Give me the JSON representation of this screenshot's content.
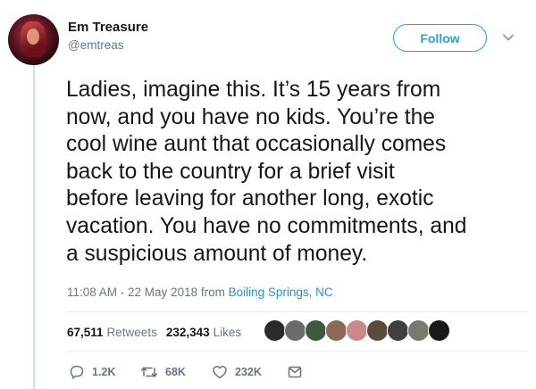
{
  "author": {
    "name": "Em Treasure",
    "handle": "@emtreas"
  },
  "follow": {
    "label": "Follow"
  },
  "tweet": {
    "text": "Ladies, imagine this. It’s 15 years from\nnow, and you have no kids. You’re the\ncool wine aunt that occasionally comes\nback to the country for a brief visit\nbefore leaving for another long, exotic\nvacation. You have no commitments, and\na suspicious amount of money.",
    "timestamp": "11:08 AM - 22 May 2018",
    "from": "from",
    "location": "Boiling Springs, NC"
  },
  "stats": {
    "retweets_count": "67,511",
    "retweets_label": "Retweets",
    "likes_count": "232,343",
    "likes_label": "Likes"
  },
  "actions": {
    "reply_count": "1.2K",
    "retweet_count": "68K",
    "like_count": "232K"
  },
  "colors": {
    "accent": "#1da1f2",
    "link": "#1b95e0",
    "muted": "#657786",
    "thread_line": "#c4e4f7"
  },
  "icons": [
    "chevron-down-icon",
    "reply-icon",
    "retweet-icon",
    "heart-icon",
    "mail-icon"
  ]
}
